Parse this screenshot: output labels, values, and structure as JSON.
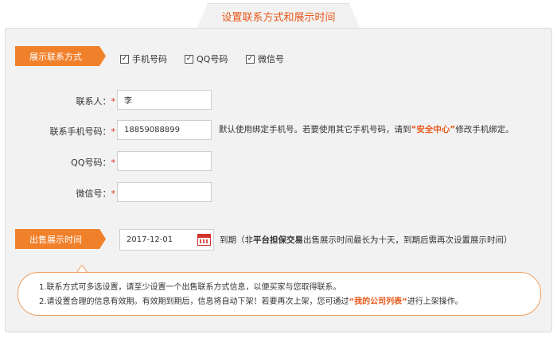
{
  "header": {
    "title": "设置联系方式和展示时间"
  },
  "contact_section": {
    "tag": "展示联系方式",
    "checkboxes": [
      {
        "label": "手机号码",
        "checked": true
      },
      {
        "label": "QQ号码",
        "checked": true
      },
      {
        "label": "微信号",
        "checked": true
      }
    ]
  },
  "fields": {
    "contact_person": {
      "label": "联系人：",
      "required": "*",
      "value": "李"
    },
    "mobile": {
      "label": "联系手机号码：",
      "required": "*",
      "value": "18859088899"
    },
    "qq": {
      "label": "QQ号码：",
      "required": "*",
      "value": ""
    },
    "wechat": {
      "label": "微信号：",
      "required": "*",
      "value": ""
    }
  },
  "mobile_hint": {
    "before": "默认使用绑定手机号。若要使用其它手机号码，请到",
    "link": "“安全中心”",
    "after": "修改手机绑定。"
  },
  "display_section": {
    "tag": "出售展示时间",
    "date_value": "2017-12-01",
    "expiry_prefix": "到期（非",
    "expiry_bold": "平台担保交易",
    "expiry_suffix": "出售展示时间最长为十天，到期后需再次设置展示时间）"
  },
  "notice": {
    "line1": "1.联系方式可多选设置，请至少设置一个出售联系方式信息，以便买家与您取得联系。",
    "line2_before": "2.请设置合理的信息有效期。有效期到期后，信息将自动下架！若要再次上架，您可通过",
    "line2_link": "“我的公司列表”",
    "line2_after": "进行上架操作。"
  },
  "colors": {
    "accent": "#f0802a",
    "accent_text": "#e8581a",
    "required": "#e0301e",
    "panel_bg": "#f2f2f2"
  },
  "icons": {
    "calendar": "calendar-icon",
    "checkmark": "checkmark-icon"
  }
}
